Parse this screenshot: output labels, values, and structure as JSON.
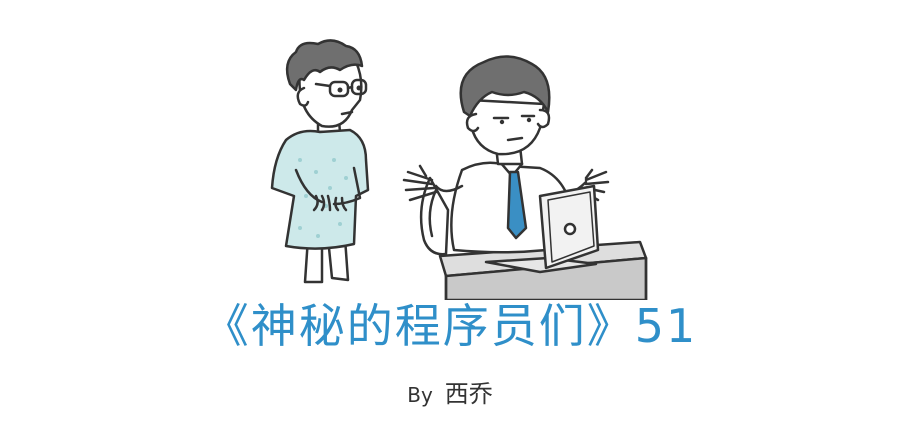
{
  "comic": {
    "title": "《神秘的程序员们》51",
    "byline_prefix": "By",
    "author": "西乔"
  },
  "colors": {
    "title": "#2f8fc9",
    "gown": "#cde9ea",
    "tie": "#3a8fc4",
    "hair": "#6f6f6f",
    "desk": "#c9c9c9",
    "outline": "#333333"
  }
}
